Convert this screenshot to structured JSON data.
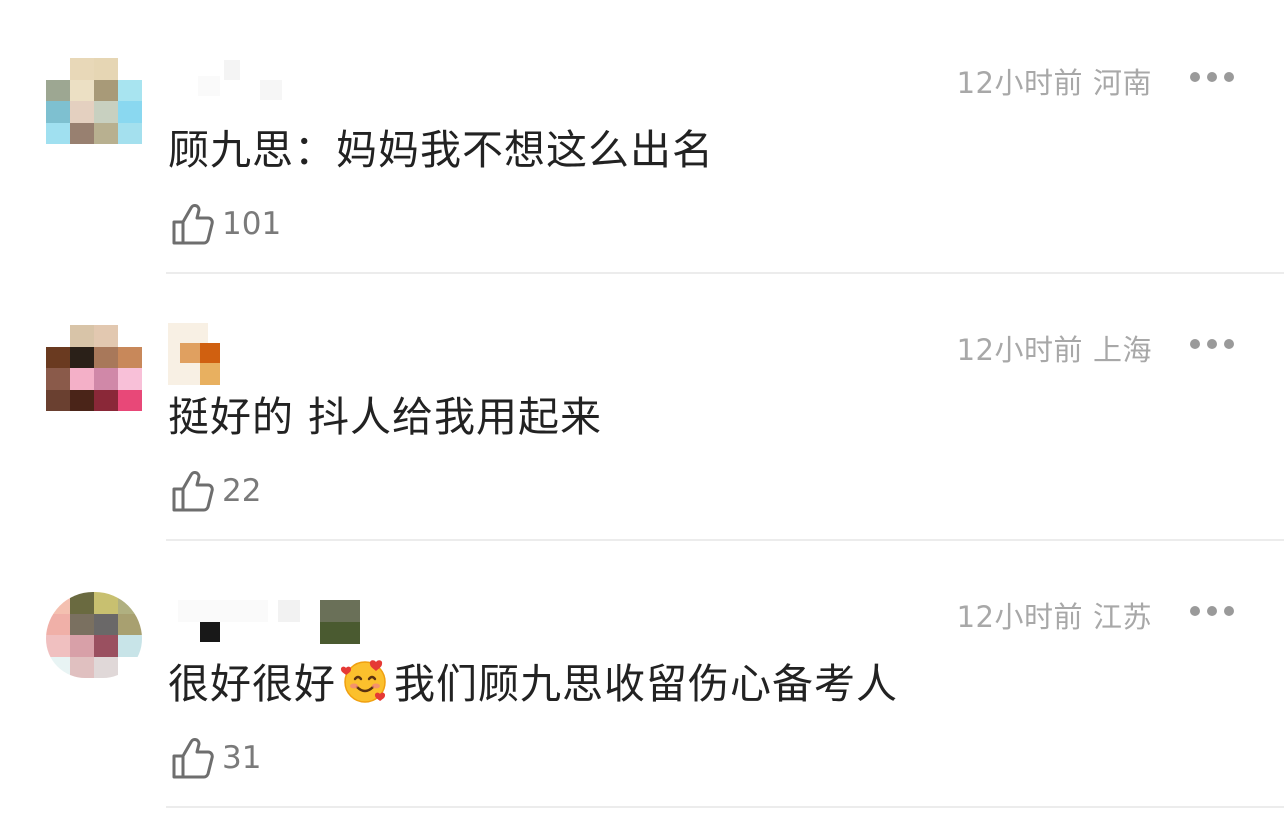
{
  "comments": [
    {
      "time": "12小时前",
      "region": "河南",
      "text": "顾九思：妈妈我不想这么出名",
      "likes": "101",
      "avatar_colors": [
        "#ffffff",
        "#e8d8b8",
        "#e6d6b4",
        "#ffffff",
        "#9da792",
        "#ece0c4",
        "#a89a78",
        "#a8e4f0",
        "#7ec0d0",
        "#e4d0c0",
        "#c8d0c0",
        "#8ad8f0",
        "#a0e0f0",
        "#988070",
        "#b8b090",
        "#a4e0ee"
      ],
      "name_colors": [
        "#fafafa",
        "#f4f4f4",
        "#f6f6f6"
      ]
    },
    {
      "time": "12小时前",
      "region": "上海",
      "text": "挺好的 抖人给我用起来",
      "likes": "22",
      "avatar_colors": [
        "#ffffff",
        "#d8c4a8",
        "#e2c8b0",
        "#ffffff",
        "#6a3a20",
        "#2a2018",
        "#a8785a",
        "#c8885a",
        "#8a5a4a",
        "#f4b0c8",
        "#d088a8",
        "#f8c0d8",
        "#6a4030",
        "#4a2418",
        "#8a2838",
        "#e84878"
      ],
      "name_colors": [
        "#f8f0e4",
        "#e0a060",
        "#d06010",
        "#e8b060"
      ]
    },
    {
      "time": "12小时前",
      "region": "江苏",
      "text_before": "很好很好",
      "text_after": "我们顾九思收留伤心备考人",
      "likes": "31",
      "avatar_colors": [
        "#f4c0b0",
        "#6a6a40",
        "#c8c070",
        "#b0b080",
        "#f0b0a8",
        "#7a7060",
        "#6a6868",
        "#a8a070",
        "#f0c0c0",
        "#d8a0a8",
        "#9a5060",
        "#c8e4e8",
        "#e8f4f4",
        "#e0c0c0",
        "#e0d8d8",
        "#ffffff"
      ],
      "name_colors": [
        "#fafafa",
        "#181818",
        "#f2f2f2",
        "#6a7058",
        "#4a5a30"
      ]
    }
  ]
}
